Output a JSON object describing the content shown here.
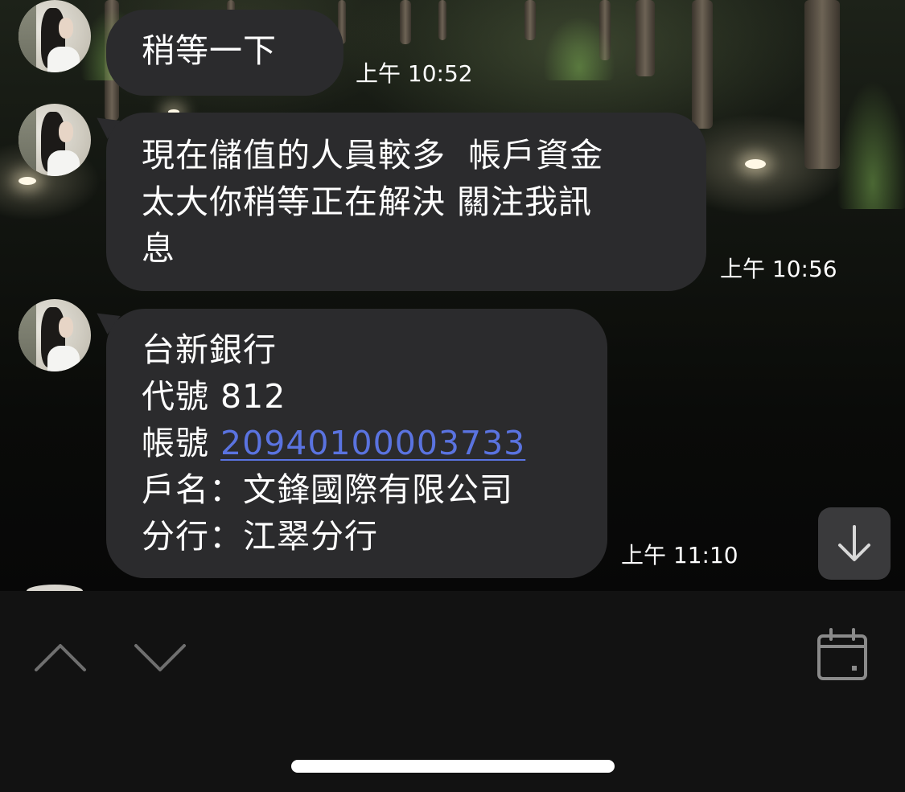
{
  "messages": [
    {
      "lines": [
        "稍等一下"
      ],
      "time": "上午 10:52"
    },
    {
      "lines": [
        "現在儲值的人員較多  帳戶資金",
        "太大你稍等正在解決 關注我訊",
        "息"
      ],
      "time": "上午 10:56"
    },
    {
      "line1": "台新銀行",
      "line2": "代號 812",
      "line3_prefix": "帳號 ",
      "account_number": "20940100003733",
      "line4": "戶名：文鋒國際有限公司",
      "line5": "分行：江翠分行",
      "time": "上午 11:10"
    }
  ],
  "colors": {
    "bubble": "#2b2b2d",
    "link": "#5a73e0",
    "bottom_bar": "#121212"
  },
  "icons": {
    "scroll_down": "arrow-down-icon",
    "previous": "chevron-up-icon",
    "next": "chevron-down-icon",
    "calendar": "calendar-icon"
  }
}
